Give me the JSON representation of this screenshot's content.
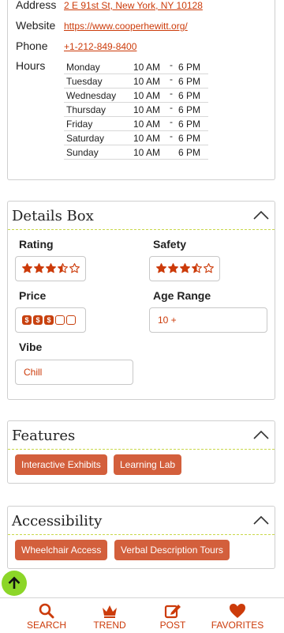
{
  "info": {
    "address_label": "Address",
    "address_value": "2 E 91st St, New York, NY 10128",
    "website_label": "Website",
    "website_value": "https://www.cooperhewitt.org/",
    "phone_label": "Phone",
    "phone_value": "+1-212-849-8400",
    "hours_label": "Hours",
    "hours": [
      {
        "day": "Monday",
        "open": "10 AM",
        "dash": "-",
        "close": "6 PM"
      },
      {
        "day": "Tuesday",
        "open": "10 AM",
        "dash": "-",
        "close": "6 PM"
      },
      {
        "day": "Wednesday",
        "open": "10 AM",
        "dash": "-",
        "close": "6 PM"
      },
      {
        "day": "Thursday",
        "open": "10 AM",
        "dash": "-",
        "close": "6 PM"
      },
      {
        "day": "Friday",
        "open": "10 AM",
        "dash": "-",
        "close": "6 PM"
      },
      {
        "day": "Saturday",
        "open": "10 AM",
        "dash": "-",
        "close": "6 PM"
      },
      {
        "day": "Sunday",
        "open": "10 AM",
        "close": "6 PM"
      }
    ]
  },
  "details": {
    "title": "Details Box",
    "rating_label": "Rating",
    "rating_stars": 3.5,
    "safety_label": "Safety",
    "safety_stars": 3.5,
    "price_label": "Price",
    "price_symbol": "$",
    "price_level": 3,
    "price_max": 5,
    "age_label": "Age Range",
    "age_value": "10 +",
    "vibe_label": "Vibe",
    "vibe_value": "Chill"
  },
  "features": {
    "title": "Features",
    "chips": [
      "Interactive Exhibits",
      "Learning Lab"
    ]
  },
  "accessibility": {
    "title": "Accessibility",
    "chips": [
      "Wheelchair Access",
      "Verbal Description Tours"
    ]
  },
  "nav": {
    "search": "SEARCH",
    "trend": "TREND",
    "post": "POST",
    "favorites": "FAVORITES"
  },
  "colors": {
    "accent": "#cc3b0a",
    "chip": "#d35f3c",
    "top_button": "#8cd628",
    "divider": "#c8d84a"
  },
  "icons": {
    "collapse": "chevron-up-icon",
    "back_to_top": "arrow-up-icon",
    "search": "search-icon",
    "trend": "crown-icon",
    "post": "edit-icon",
    "favorites": "heart-icon"
  }
}
